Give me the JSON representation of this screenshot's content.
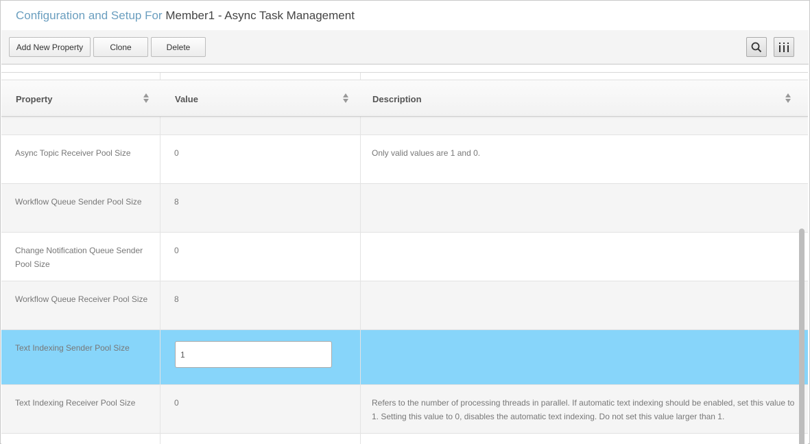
{
  "header": {
    "title_prefix": "Configuration and Setup For",
    "title_name": "Member1 - Async Task Management"
  },
  "toolbar": {
    "add_label": "Add New Property",
    "clone_label": "Clone",
    "delete_label": "Delete",
    "search_icon": "search-icon",
    "columns_icon": "columns-icon"
  },
  "table": {
    "columns": [
      "Property",
      "Value",
      "Description"
    ],
    "rows": [
      {
        "property": "",
        "value": "",
        "description": ""
      },
      {
        "property": "Async Topic Receiver Pool Size",
        "value": "0",
        "description": "Only valid values are 1 and 0."
      },
      {
        "property": "Workflow Queue Sender Pool Size",
        "value": "8",
        "description": ""
      },
      {
        "property": "Change Notification Queue Sender Pool Size",
        "value": "0",
        "description": ""
      },
      {
        "property": "Workflow Queue Receiver Pool Size",
        "value": "8",
        "description": ""
      },
      {
        "property": "Text Indexing Sender Pool Size",
        "value": "1",
        "description": ""
      },
      {
        "property": "Text Indexing Receiver Pool Size",
        "value": "0",
        "description": "Refers to the number of processing threads in parallel. If automatic text indexing should be enabled, set this value to 1. Setting this value to 0, disables the automatic text indexing. Do not set this value larger than 1."
      }
    ]
  },
  "colors": {
    "title_accent": "#6a9ebf",
    "selected_row": "#87d5fa"
  }
}
